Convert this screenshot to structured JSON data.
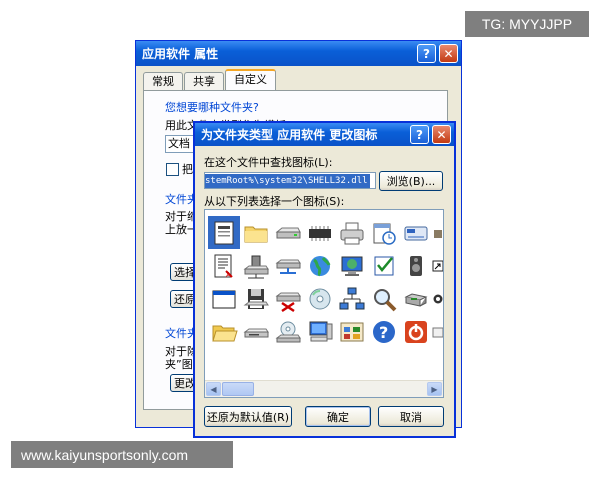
{
  "watermark_top": "TG: MYYJJPP",
  "watermark_bottom": "www.kaiyunsportsonly.com",
  "properties_window": {
    "title": "应用软件  属性",
    "help_btn": "?",
    "close_btn": "✕",
    "tabs": [
      "常规",
      "共享",
      "自定义"
    ],
    "group1_title": "您想要哪种文件夹?",
    "group1_label": "用此文件夹类型作为模板",
    "group1_dropdown": "文档",
    "group1_checkbox": "把",
    "group2_title": "文件夹",
    "group2_desc1": "对于缩",
    "group2_desc2": "上放一",
    "choose_btn": "选择",
    "restore_btn": "还原",
    "group3_title": "文件夹",
    "group3_desc1": "对于除",
    "group3_desc2": "夹”图",
    "change_btn": "更改"
  },
  "icon_dialog": {
    "title": "为文件夹类型 应用软件 更改图标",
    "help_btn": "?",
    "close_btn": "✕",
    "find_label": "在这个文件中查找图标(L):",
    "path_value": "stemRoot%\\system32\\SHELL32.dll",
    "browse_btn": "浏览(B)...",
    "select_label": "从以下列表选择一个图标(S):",
    "icons": [
      "document-icon",
      "folder-icon",
      "drive-icon",
      "memory-chip-icon",
      "printer-icon",
      "schedule-icon",
      "card-icon",
      "text-document-icon",
      "network-drive-icon",
      "network-server-icon",
      "globe-icon",
      "monitor-globe-icon",
      "checklist-icon",
      "speaker-icon",
      "window-icon",
      "floppy-disk-icon",
      "disconnected-drive-icon",
      "cd-icon",
      "network-icon",
      "search-icon",
      "recycle-icon",
      "open-folder-icon",
      "removable-drive-icon",
      "cd-drive-icon",
      "computer-icon",
      "control-panel-icon",
      "help-icon",
      "power-icon"
    ],
    "selected_index": 0,
    "restore_default_btn": "还原为默认值(R)",
    "ok_btn": "确定",
    "cancel_btn": "取消"
  }
}
